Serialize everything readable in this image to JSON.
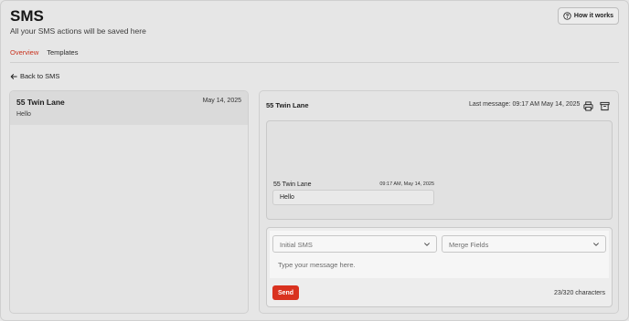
{
  "page": {
    "title": "SMS",
    "subtitle": "All your SMS actions will be saved here",
    "how_it_works_label": "How it works"
  },
  "tabs": [
    {
      "label": "Overview",
      "active": true
    },
    {
      "label": "Templates",
      "active": false
    }
  ],
  "back_link_label": "Back to SMS",
  "conversations": [
    {
      "name": "55 Twin Lane",
      "date": "May 14, 2025",
      "preview": "Hello"
    }
  ],
  "chat": {
    "recipient": "55 Twin Lane",
    "last_message": "Last message: 09:17 AM May 14, 2025",
    "messages": [
      {
        "sender": "55 Twin Lane",
        "time": "09:17 AM, May 14, 2025",
        "text": "Hello"
      }
    ]
  },
  "composer": {
    "template_select": "Initial SMS",
    "merge_select": "Merge Fields",
    "placeholder": "Type your message here.",
    "send_label": "Send",
    "char_count": "23/320 characters"
  },
  "colors": {
    "accent": "#c8321e",
    "send_button": "#d9321f",
    "background": "#e6e6e6"
  },
  "icons": [
    "help-circle-icon",
    "arrow-left-icon",
    "printer-icon",
    "trash-icon",
    "chevron-down-icon"
  ]
}
